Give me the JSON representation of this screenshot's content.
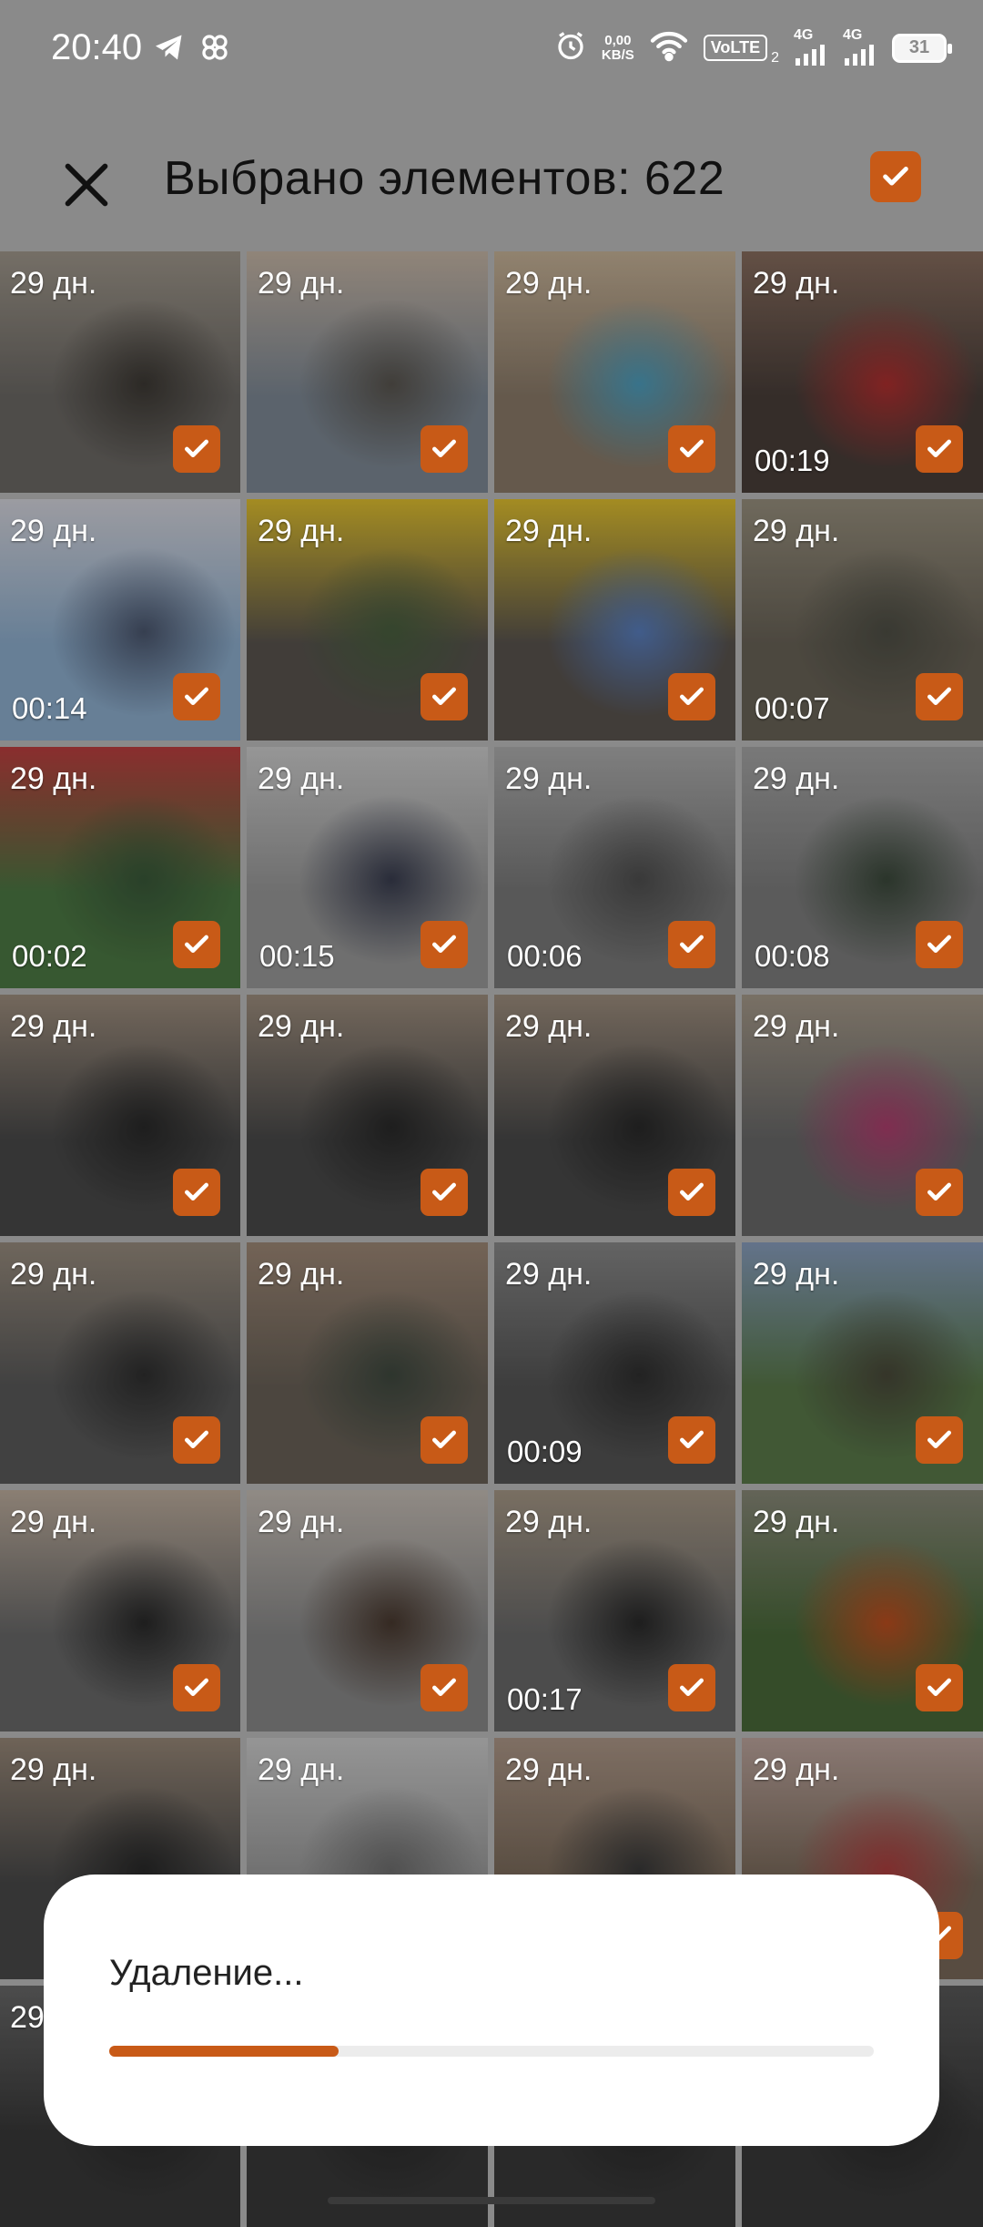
{
  "status_bar": {
    "time": "20:40",
    "net_speed_value": "0,00",
    "net_speed_unit": "KB/S",
    "volte": "VoLTE",
    "sim_index": "2",
    "sig1": "4G",
    "sig2": "4G",
    "battery": "31"
  },
  "header": {
    "title": "Выбрано элементов: 622"
  },
  "tiles": [
    {
      "date": "29 дн.",
      "duration": "",
      "palette": [
        "#6d6a66",
        "#a29a8e",
        "#3e3a35"
      ]
    },
    {
      "date": "29 дн.",
      "duration": "",
      "palette": [
        "#7f8a96",
        "#c8b8a8",
        "#5a5650"
      ]
    },
    {
      "date": "29 дн.",
      "duration": "",
      "palette": [
        "#8c7c6a",
        "#c9b59a",
        "#4fa0c0"
      ]
    },
    {
      "date": "29 дн.",
      "duration": "00:19",
      "palette": [
        "#4a3f3a",
        "#8a6f60",
        "#b23030"
      ]
    },
    {
      "date": "29 дн.",
      "duration": "00:14",
      "palette": [
        "#8fb0d0",
        "#d8d8e0",
        "#4c5870"
      ]
    },
    {
      "date": "29 дн.",
      "duration": "",
      "palette": [
        "#5a5550",
        "#e3c230",
        "#4a6040"
      ]
    },
    {
      "date": "29 дн.",
      "duration": "",
      "palette": [
        "#5a5550",
        "#e3c230",
        "#5a80c0"
      ]
    },
    {
      "date": "29 дн.",
      "duration": "00:07",
      "palette": [
        "#6a6458",
        "#9a9280",
        "#505046"
      ]
    },
    {
      "date": "29 дн.",
      "duration": "00:02",
      "palette": [
        "#4d7a44",
        "#c04040",
        "#3a5a3a"
      ]
    },
    {
      "date": "29 дн.",
      "duration": "00:15",
      "palette": [
        "#9a9a9a",
        "#d0d0d0",
        "#3a3e50"
      ]
    },
    {
      "date": "29 дн.",
      "duration": "00:06",
      "palette": [
        "#7a7a7a",
        "#b0b0b0",
        "#505050"
      ]
    },
    {
      "date": "29 дн.",
      "duration": "00:08",
      "palette": [
        "#7e7e7e",
        "#a8a8a8",
        "#3c4a3c"
      ]
    },
    {
      "date": "29 дн.",
      "duration": "",
      "palette": [
        "#4a4a4a",
        "#a09080",
        "#2a2a2a"
      ]
    },
    {
      "date": "29 дн.",
      "duration": "",
      "palette": [
        "#4a4a4a",
        "#a09080",
        "#2a2a2a"
      ]
    },
    {
      "date": "29 дн.",
      "duration": "",
      "palette": [
        "#4a4a4a",
        "#a09080",
        "#2a2a2a"
      ]
    },
    {
      "date": "29 дн.",
      "duration": "",
      "palette": [
        "#6a6a6a",
        "#a89c8c",
        "#b04070"
      ]
    },
    {
      "date": "29 дн.",
      "duration": "",
      "palette": [
        "#5a5a5a",
        "#9a8e80",
        "#303030"
      ]
    },
    {
      "date": "29 дн.",
      "duration": "",
      "palette": [
        "#6a6258",
        "#a08a78",
        "#404a40"
      ]
    },
    {
      "date": "29 дн.",
      "duration": "00:09",
      "palette": [
        "#555555",
        "#8a8a8a",
        "#303030"
      ]
    },
    {
      "date": "29 дн.",
      "duration": "",
      "palette": [
        "#5a7a4a",
        "#8aa0c0",
        "#4a4a3a"
      ]
    },
    {
      "date": "29 дн.",
      "duration": "",
      "palette": [
        "#6a6a6a",
        "#c0b0a0",
        "#2a2a2a"
      ]
    },
    {
      "date": "29 дн.",
      "duration": "",
      "palette": [
        "#8a8a8a",
        "#c8c0b8",
        "#4a3a30"
      ]
    },
    {
      "date": "29 дн.",
      "duration": "00:17",
      "palette": [
        "#6a6a6a",
        "#a89a88",
        "#2a2a2a"
      ]
    },
    {
      "date": "29 дн.",
      "duration": "",
      "palette": [
        "#4a6a3a",
        "#8a8a7a",
        "#c05020"
      ]
    },
    {
      "date": "29 дн.",
      "duration": "",
      "palette": [
        "#4a4a4a",
        "#9a8a7a",
        "#2a2a2a"
      ]
    },
    {
      "date": "29 дн.",
      "duration": "",
      "palette": [
        "#9a9a9a",
        "#cfcfcf",
        "#707070"
      ]
    },
    {
      "date": "29 дн.",
      "duration": "",
      "palette": [
        "#7a6a5a",
        "#b09a8a",
        "#3a3a3a"
      ]
    },
    {
      "date": "29 дн.",
      "duration": "",
      "palette": [
        "#7a6a5a",
        "#c0a8a0",
        "#b04040"
      ]
    },
    {
      "date": "29",
      "duration": "",
      "palette": [
        "#3a3a3a",
        "#6a6a6a",
        "#2a2a2a"
      ]
    },
    {
      "date": "",
      "duration": "",
      "palette": [
        "#3a3a3a",
        "#5a5a5a",
        "#2a2a2a"
      ]
    },
    {
      "date": "",
      "duration": "",
      "palette": [
        "#3a3a3a",
        "#5a5a5a",
        "#2a2a2a"
      ]
    },
    {
      "date": "",
      "duration": "",
      "palette": [
        "#3a3a3a",
        "#5a5a5a",
        "#2a2a2a"
      ]
    }
  ],
  "dialog": {
    "text": "Удаление...",
    "progress": 0.3
  },
  "colors": {
    "accent": "#c85a17",
    "scrim": "#8a8a8a"
  }
}
